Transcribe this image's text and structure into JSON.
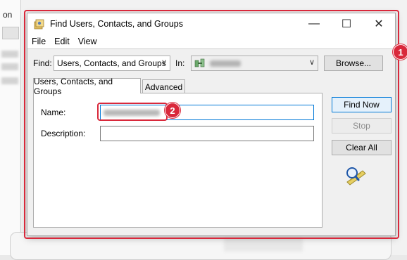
{
  "background_app": {
    "left_text": "on"
  },
  "dialog": {
    "title": "Find Users, Contacts, and Groups",
    "controls": {
      "minimize": "—",
      "maximize": "☐",
      "close": "✕"
    },
    "menu": [
      "File",
      "Edit",
      "View"
    ],
    "find": {
      "label": "Find:",
      "selected": "Users, Contacts, and Groups",
      "in_label": "In:",
      "browse_label": "Browse..."
    },
    "tabs": [
      "Users, Contacts, and Groups",
      "Advanced"
    ],
    "fields": {
      "name_label": "Name:",
      "description_label": "Description:"
    },
    "buttons": {
      "find_now": "Find Now",
      "stop": "Stop",
      "clear_all": "Clear All"
    }
  },
  "annotations": [
    "1",
    "2"
  ],
  "colors": {
    "annotation_red": "#d9283b",
    "focus_blue": "#0078d7"
  },
  "icons": {
    "app": "find-users-icon",
    "in_domain": "domain-icon",
    "search_animation": "magnifier-search-icon"
  }
}
